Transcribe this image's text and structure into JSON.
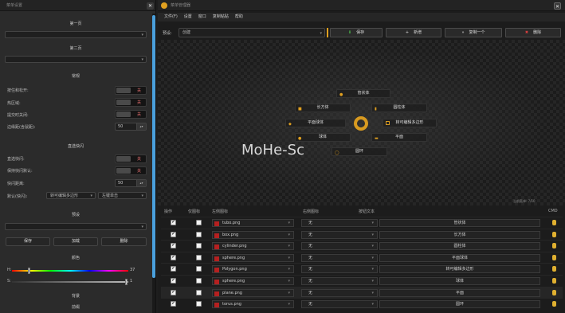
{
  "left_panel": {
    "title": "菜单设置",
    "close": "✕",
    "page1": "第一页",
    "page2": "第二页",
    "general": "常规",
    "rows": [
      {
        "label": "按住和松开:",
        "value": "关"
      },
      {
        "label": "热区域:",
        "value": "关"
      },
      {
        "label": "提交时关闭:",
        "value": "关"
      }
    ],
    "spacing_label": "边缘距(含鼠距):",
    "spacing_value": "50",
    "quick": "直选快闪",
    "quick_rows": [
      {
        "label": "直选快闪:",
        "value": "关"
      },
      {
        "label": "保持快闪默认:",
        "value": "关"
      }
    ],
    "quick_dist_label": "快闪距离:",
    "quick_dist_value": "50",
    "default_label": "默认(快闪):",
    "default_opt1": "转可编辑多边形",
    "default_opt2": "左键单击",
    "preset": "预设",
    "save": "保存",
    "load": "加载",
    "delete": "删除",
    "color": "颜色",
    "h_label": "H:",
    "h_value": "37",
    "s_label": "S:",
    "s_value": "1",
    "bg": "背景",
    "bg2": "前缀"
  },
  "window": {
    "title": "菜单管理器",
    "close": "✕",
    "menu": [
      "文件(F)",
      "设置",
      "窗口",
      "复制粘贴",
      "帮助"
    ],
    "preset_label": "预设:",
    "preset_value": "创建",
    "buttons": {
      "save": "保存",
      "new": "新增",
      "copy": "复制一个",
      "delete": "删除"
    },
    "count": "当前菜单: 7/10",
    "radial_items": [
      "管状体",
      "长方体",
      "圆柱体",
      "平面球体",
      "转可编辑多边形",
      "球体",
      "平面",
      "圆环"
    ],
    "center_icon": "ring-icon",
    "watermark": "MoHe-Sc"
  },
  "table": {
    "headers": [
      "操作",
      "仅图标",
      "左侧图标",
      "右侧图标",
      "按钮文本",
      "CMD"
    ],
    "rows": [
      {
        "icon": "tubo.png",
        "right": "无",
        "text": "管状体"
      },
      {
        "icon": "box.png",
        "right": "无",
        "text": "长方体"
      },
      {
        "icon": "cylinder.png",
        "right": "无",
        "text": "圆柱体"
      },
      {
        "icon": "sphere.png",
        "right": "无",
        "text": "平面球体"
      },
      {
        "icon": "Polygon.png",
        "right": "无",
        "text": "转可编辑多边形"
      },
      {
        "icon": "sphere.png",
        "right": "无",
        "text": "球体"
      },
      {
        "icon": "plane.png",
        "right": "无",
        "text": "平面"
      },
      {
        "icon": "torus.png",
        "right": "无",
        "text": "圆环"
      }
    ],
    "check": "✔"
  },
  "colors": {
    "accent": "#4aa0dc",
    "off": "#e87070",
    "icon_gold": "#e0a020",
    "add_green": "#4cbf4c",
    "del_red": "#e04040"
  }
}
